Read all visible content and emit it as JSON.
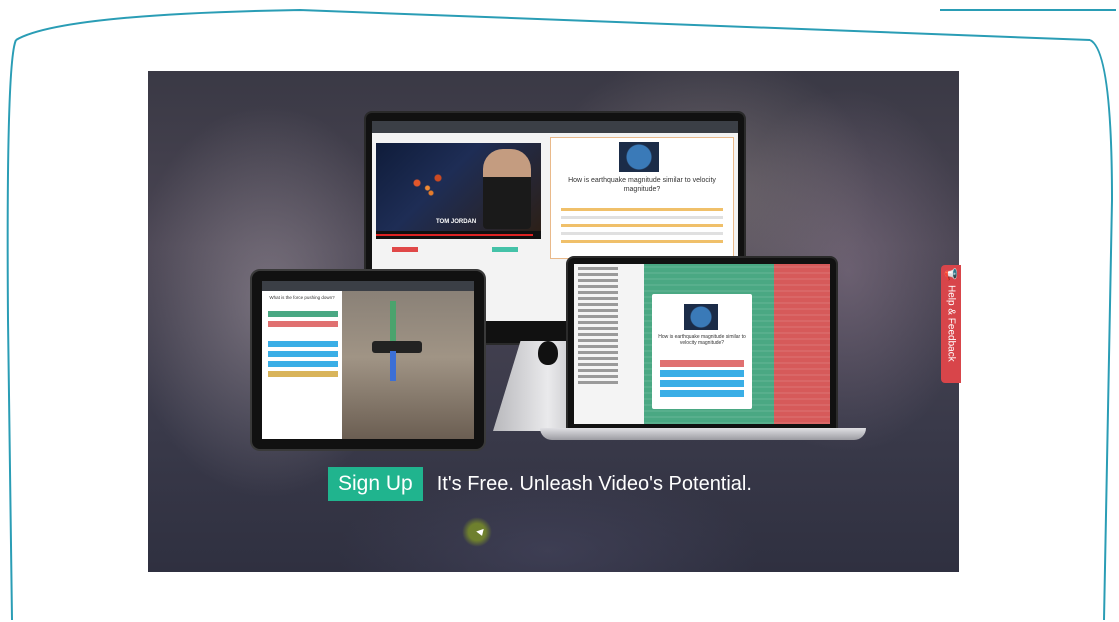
{
  "hero": {
    "cta": {
      "signup_label": "Sign Up",
      "tagline": "It's Free. Unleash Video's Potential."
    },
    "desktop_question": "How is earthquake magnitude similar to velocity magnitude?",
    "desktop_caption": "TOM JORDAN",
    "tablet_question": "What is the force pushing down?",
    "laptop_question": "How is earthquake magnitude similar to velocity magnitude?"
  },
  "feedback": {
    "label": "Help & Feedback",
    "icon": "megaphone-icon"
  },
  "colors": {
    "accent": "#20b48e",
    "feedback": "#d8454a",
    "frame": "#2a9db5"
  }
}
